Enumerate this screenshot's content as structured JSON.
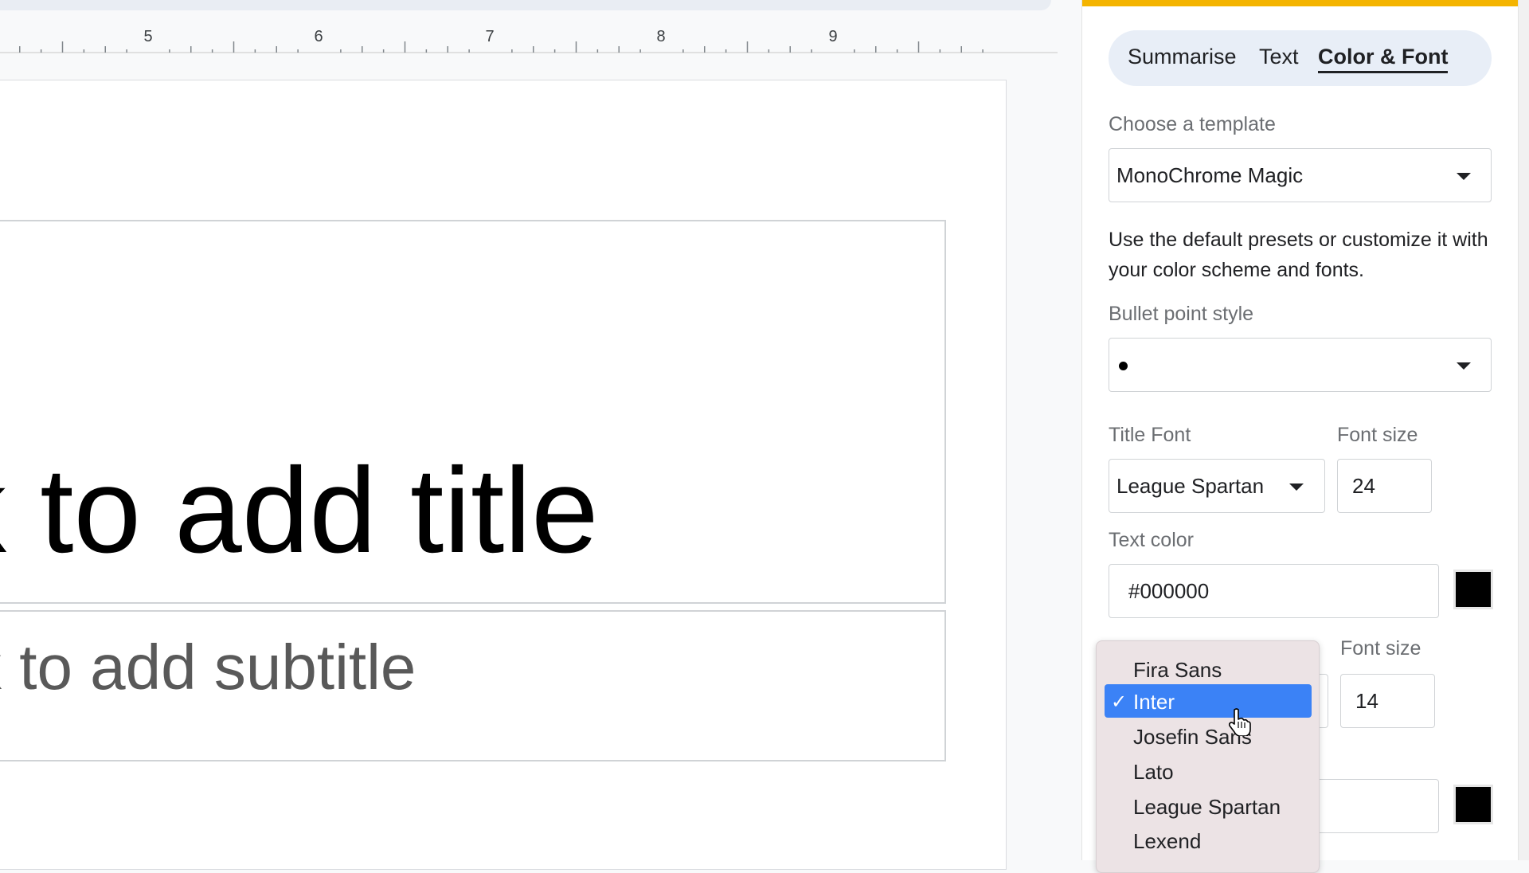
{
  "ruler": {
    "numbers": [
      "5",
      "6",
      "7",
      "8",
      "9"
    ]
  },
  "slide": {
    "title_placeholder": "k to add title",
    "subtitle_placeholder": "k to add subtitle"
  },
  "panel": {
    "tabs": [
      {
        "label": "Summarise",
        "active": false
      },
      {
        "label": "Text",
        "active": false
      },
      {
        "label": "Color & Font",
        "active": true
      }
    ],
    "template": {
      "label": "Choose a template",
      "value": "MonoChrome Magic"
    },
    "description": "Use the default presets or customize it with your color scheme and fonts.",
    "bullet": {
      "label": "Bullet point style",
      "value": "•"
    },
    "title_font": {
      "label": "Title Font",
      "value": "League Spartan"
    },
    "title_size": {
      "label": "Font size",
      "value": "24"
    },
    "text_color": {
      "label": "Text color",
      "value": "#000000",
      "swatch": "#000000"
    },
    "body_size": {
      "label": "Font size",
      "value": "14"
    },
    "body_color": {
      "swatch": "#000000"
    }
  },
  "font_menu": {
    "items": [
      {
        "label": "Fira Sans",
        "selected": false
      },
      {
        "label": "Inter",
        "selected": true,
        "check": "✓"
      },
      {
        "label": "Josefin Sans",
        "selected": false
      },
      {
        "label": "Lato",
        "selected": false
      },
      {
        "label": "League Spartan",
        "selected": false
      },
      {
        "label": "Lexend",
        "selected": false
      }
    ]
  },
  "colors": {
    "accent": "#f4b400",
    "selected": "#3b82f6",
    "tab_bg": "#e8eef7"
  }
}
